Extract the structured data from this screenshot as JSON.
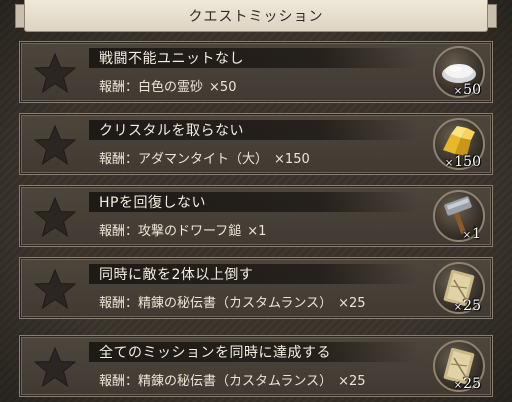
{
  "header": {
    "title": "クエストミッション"
  },
  "reward_prefix": "報酬：",
  "missions": [
    {
      "title": "戦闘不能ユニットなし",
      "reward_item": "白色の霊砂",
      "reward_mult": "×50",
      "quantity": "50",
      "icon": "white-sand-icon"
    },
    {
      "title": "クリスタルを取らない",
      "reward_item": "アダマンタイト（大）",
      "reward_mult": "×150",
      "quantity": "150",
      "icon": "adamantite-icon"
    },
    {
      "title": "HPを回復しない",
      "reward_item": "攻撃のドワーフ鎚",
      "reward_mult": "×1",
      "quantity": "1",
      "icon": "hammer-icon"
    },
    {
      "title": "同時に敵を2体以上倒す",
      "reward_item": "精錬の秘伝書（カスタムランス）",
      "reward_mult": "×25",
      "quantity": "25",
      "icon": "scroll-icon"
    },
    {
      "title": "全てのミッションを同時に達成する",
      "reward_item": "精錬の秘伝書（カスタムランス）",
      "reward_mult": "×25",
      "quantity": "25",
      "icon": "scroll-icon"
    }
  ],
  "colors": {
    "panel": "#443e35",
    "frame": "#3b352e",
    "header_bg": "#e8e0d0",
    "text_light": "#f3ede0",
    "star_empty": "#2a2520"
  }
}
